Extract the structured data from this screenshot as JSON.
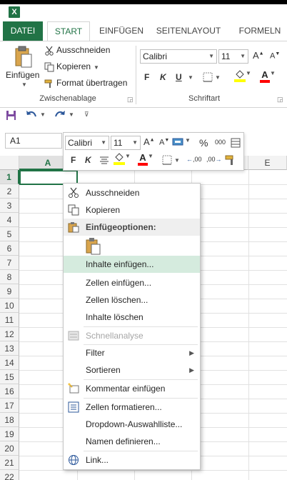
{
  "app": {
    "logo": "X"
  },
  "ribbon_tabs": [
    "DATEI",
    "START",
    "EINFÜGEN",
    "SEITENLAYOUT",
    "FORMELN"
  ],
  "clipboard": {
    "paste_label": "Einfügen",
    "cut_label": "Ausschneiden",
    "copy_label": "Kopieren",
    "format_painter_label": "Format übertragen",
    "group_label": "Zwischenablage"
  },
  "font_group": {
    "font_name": "Calibri",
    "font_size": "11",
    "grow_label": "A",
    "shrink_label": "A",
    "bold": "F",
    "italic": "K",
    "underline": "U",
    "fill_color": "#ffff00",
    "font_color": "#ff0000",
    "font_color_label": "A",
    "group_label": "Schriftart"
  },
  "name_box": {
    "value": "A1"
  },
  "mini_toolbar": {
    "font_name": "Calibri",
    "font_size": "11",
    "percent": "%",
    "thousands": "000",
    "bold": "F",
    "italic": "K",
    "font_color_label": "A",
    "inc_decimal": ",00",
    "dec_decimal": ",00"
  },
  "sheet": {
    "columns": [
      "A",
      "E"
    ],
    "rows": [
      "1",
      "2",
      "3",
      "4",
      "5",
      "6",
      "7",
      "8",
      "9",
      "10",
      "11",
      "12",
      "13",
      "14",
      "15",
      "16",
      "17",
      "18",
      "19",
      "20",
      "21",
      "22"
    ]
  },
  "context_menu": {
    "items": [
      {
        "label": "Ausschneiden",
        "icon": "scissors-icon"
      },
      {
        "label": "Kopieren",
        "icon": "copy-icon"
      },
      {
        "label": "Einfügeoptionen:",
        "icon": "paste-icon"
      },
      {
        "label": "Inhalte einfügen..."
      },
      {
        "label": "Zellen einfügen..."
      },
      {
        "label": "Zellen löschen..."
      },
      {
        "label": "Inhalte löschen"
      },
      {
        "label": "Schnellanalyse",
        "icon": "quick-analysis-icon"
      },
      {
        "label": "Filter"
      },
      {
        "label": "Sortieren"
      },
      {
        "label": "Kommentar einfügen",
        "icon": "comment-icon"
      },
      {
        "label": "Zellen formatieren...",
        "icon": "format-cells-icon"
      },
      {
        "label": "Dropdown-Auswahlliste..."
      },
      {
        "label": "Namen definieren..."
      },
      {
        "label": "Link...",
        "icon": "link-icon"
      }
    ]
  },
  "colors": {
    "accent": "#217346",
    "hover": "#d5ebde"
  }
}
